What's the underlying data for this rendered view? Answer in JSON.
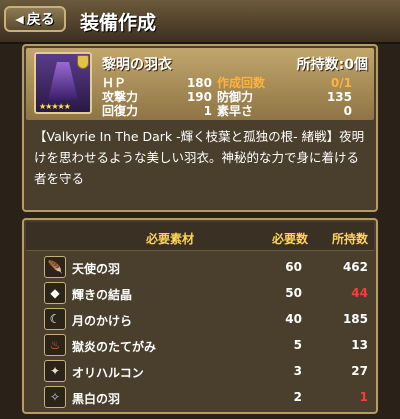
{
  "header": {
    "back_label": "戻る",
    "title": "装備作成"
  },
  "item": {
    "name": "黎明の羽衣",
    "owned_label": "所持数:0個",
    "rarity_stars": "★★★★★",
    "stats": [
      {
        "label": "ＨＰ",
        "value": "180",
        "label2": "作成回数",
        "value2": "0/1"
      },
      {
        "label": "攻撃力",
        "value": "190",
        "label2": "防御力",
        "value2": "135"
      },
      {
        "label": "回復力",
        "value": "1",
        "label2": "素早さ",
        "value2": "0"
      }
    ],
    "description": "【Valkyrie In The Dark -輝く枝葉と孤独の根- 緒戦】夜明けを思わせるような美しい羽衣。神秘的な力で身に着ける者を守る"
  },
  "materials": {
    "col_name": "必要素材",
    "col_need": "必要数",
    "col_own": "所持数",
    "rows": [
      {
        "name": "天使の羽",
        "need": "60",
        "own": "462",
        "short": false,
        "icon": "feather-icon"
      },
      {
        "name": "輝きの結晶",
        "need": "50",
        "own": "44",
        "short": true,
        "icon": "crystal-icon"
      },
      {
        "name": "月のかけら",
        "need": "40",
        "own": "185",
        "short": false,
        "icon": "moon-shard-icon"
      },
      {
        "name": "獄炎のたてがみ",
        "need": "5",
        "own": "13",
        "short": false,
        "icon": "flame-mane-icon"
      },
      {
        "name": "オリハルコン",
        "need": "3",
        "own": "27",
        "short": false,
        "icon": "orichalcum-icon"
      },
      {
        "name": "黒白の羽",
        "need": "2",
        "own": "1",
        "short": true,
        "icon": "black-white-feather-icon"
      }
    ]
  },
  "colors": {
    "shortage": "#ff3a3a",
    "highlight": "#ffb23c",
    "header_text": "#ffd45a"
  }
}
